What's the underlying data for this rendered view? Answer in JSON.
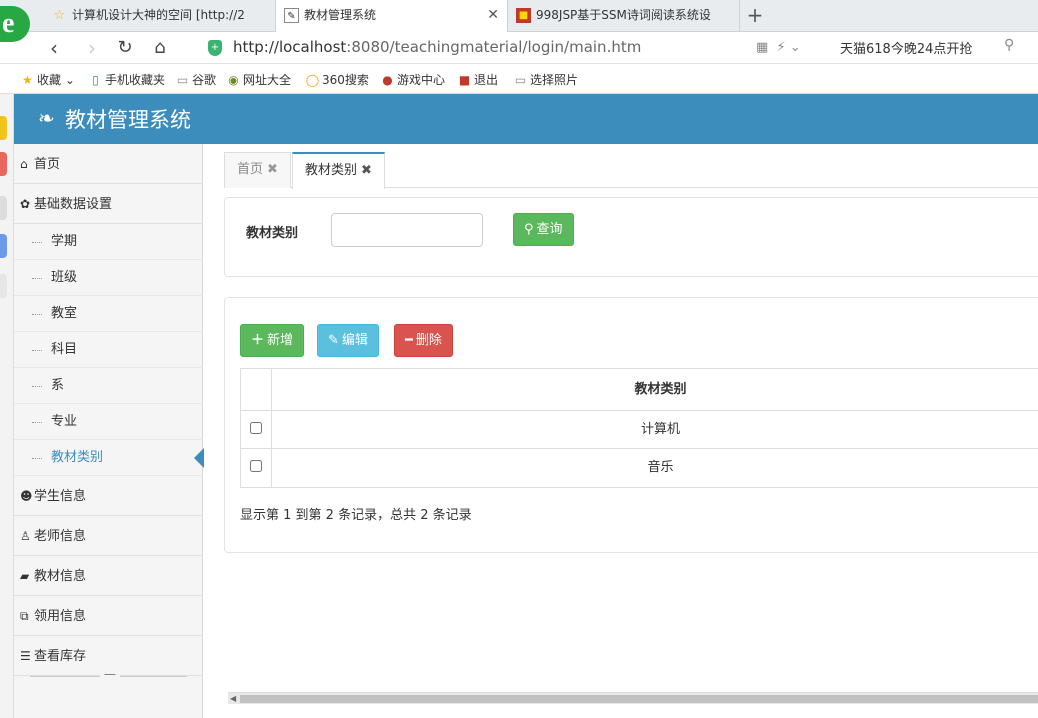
{
  "browser": {
    "tabs": [
      {
        "label": "计算机设计大神的空间 [http://2",
        "favicon": "star-icon"
      },
      {
        "label": "教材管理系统",
        "favicon": "page-icon",
        "active": true
      },
      {
        "label": "998JSP基于SSM诗词阅读系统设",
        "favicon": "gift-icon"
      }
    ],
    "url_host": "http://localhost",
    "url_path": ":8080/teachingmaterial/login/main.htm",
    "promo": "天猫618今晚24点开抢",
    "bookmarks": [
      "收藏",
      "手机收藏夹",
      "谷歌",
      "网址大全",
      "360搜索",
      "游戏中心",
      "退出",
      "选择照片"
    ]
  },
  "app": {
    "title": "教材管理系统"
  },
  "sidebar": {
    "home": "首页",
    "basic": "基础数据设置",
    "sub": [
      "学期",
      "班级",
      "教室",
      "科目",
      "系",
      "专业",
      "教材类别"
    ],
    "groups": [
      "学生信息",
      "老师信息",
      "教材信息",
      "领用信息",
      "查看库存"
    ]
  },
  "content": {
    "tabs": [
      "首页",
      "教材类别"
    ],
    "search_label": "教材类别",
    "search_button": "查询",
    "toolbar": {
      "add": "新增",
      "edit": "编辑",
      "delete": "删除"
    },
    "table": {
      "header": "教材类别",
      "rows": [
        "计算机",
        "音乐"
      ]
    },
    "pager": "显示第 1 到第 2 条记录，总共 2 条记录"
  },
  "colors": {
    "header": "#3c8dbc",
    "success": "#5cb85c",
    "info": "#5bc0de",
    "danger": "#d9534f"
  }
}
